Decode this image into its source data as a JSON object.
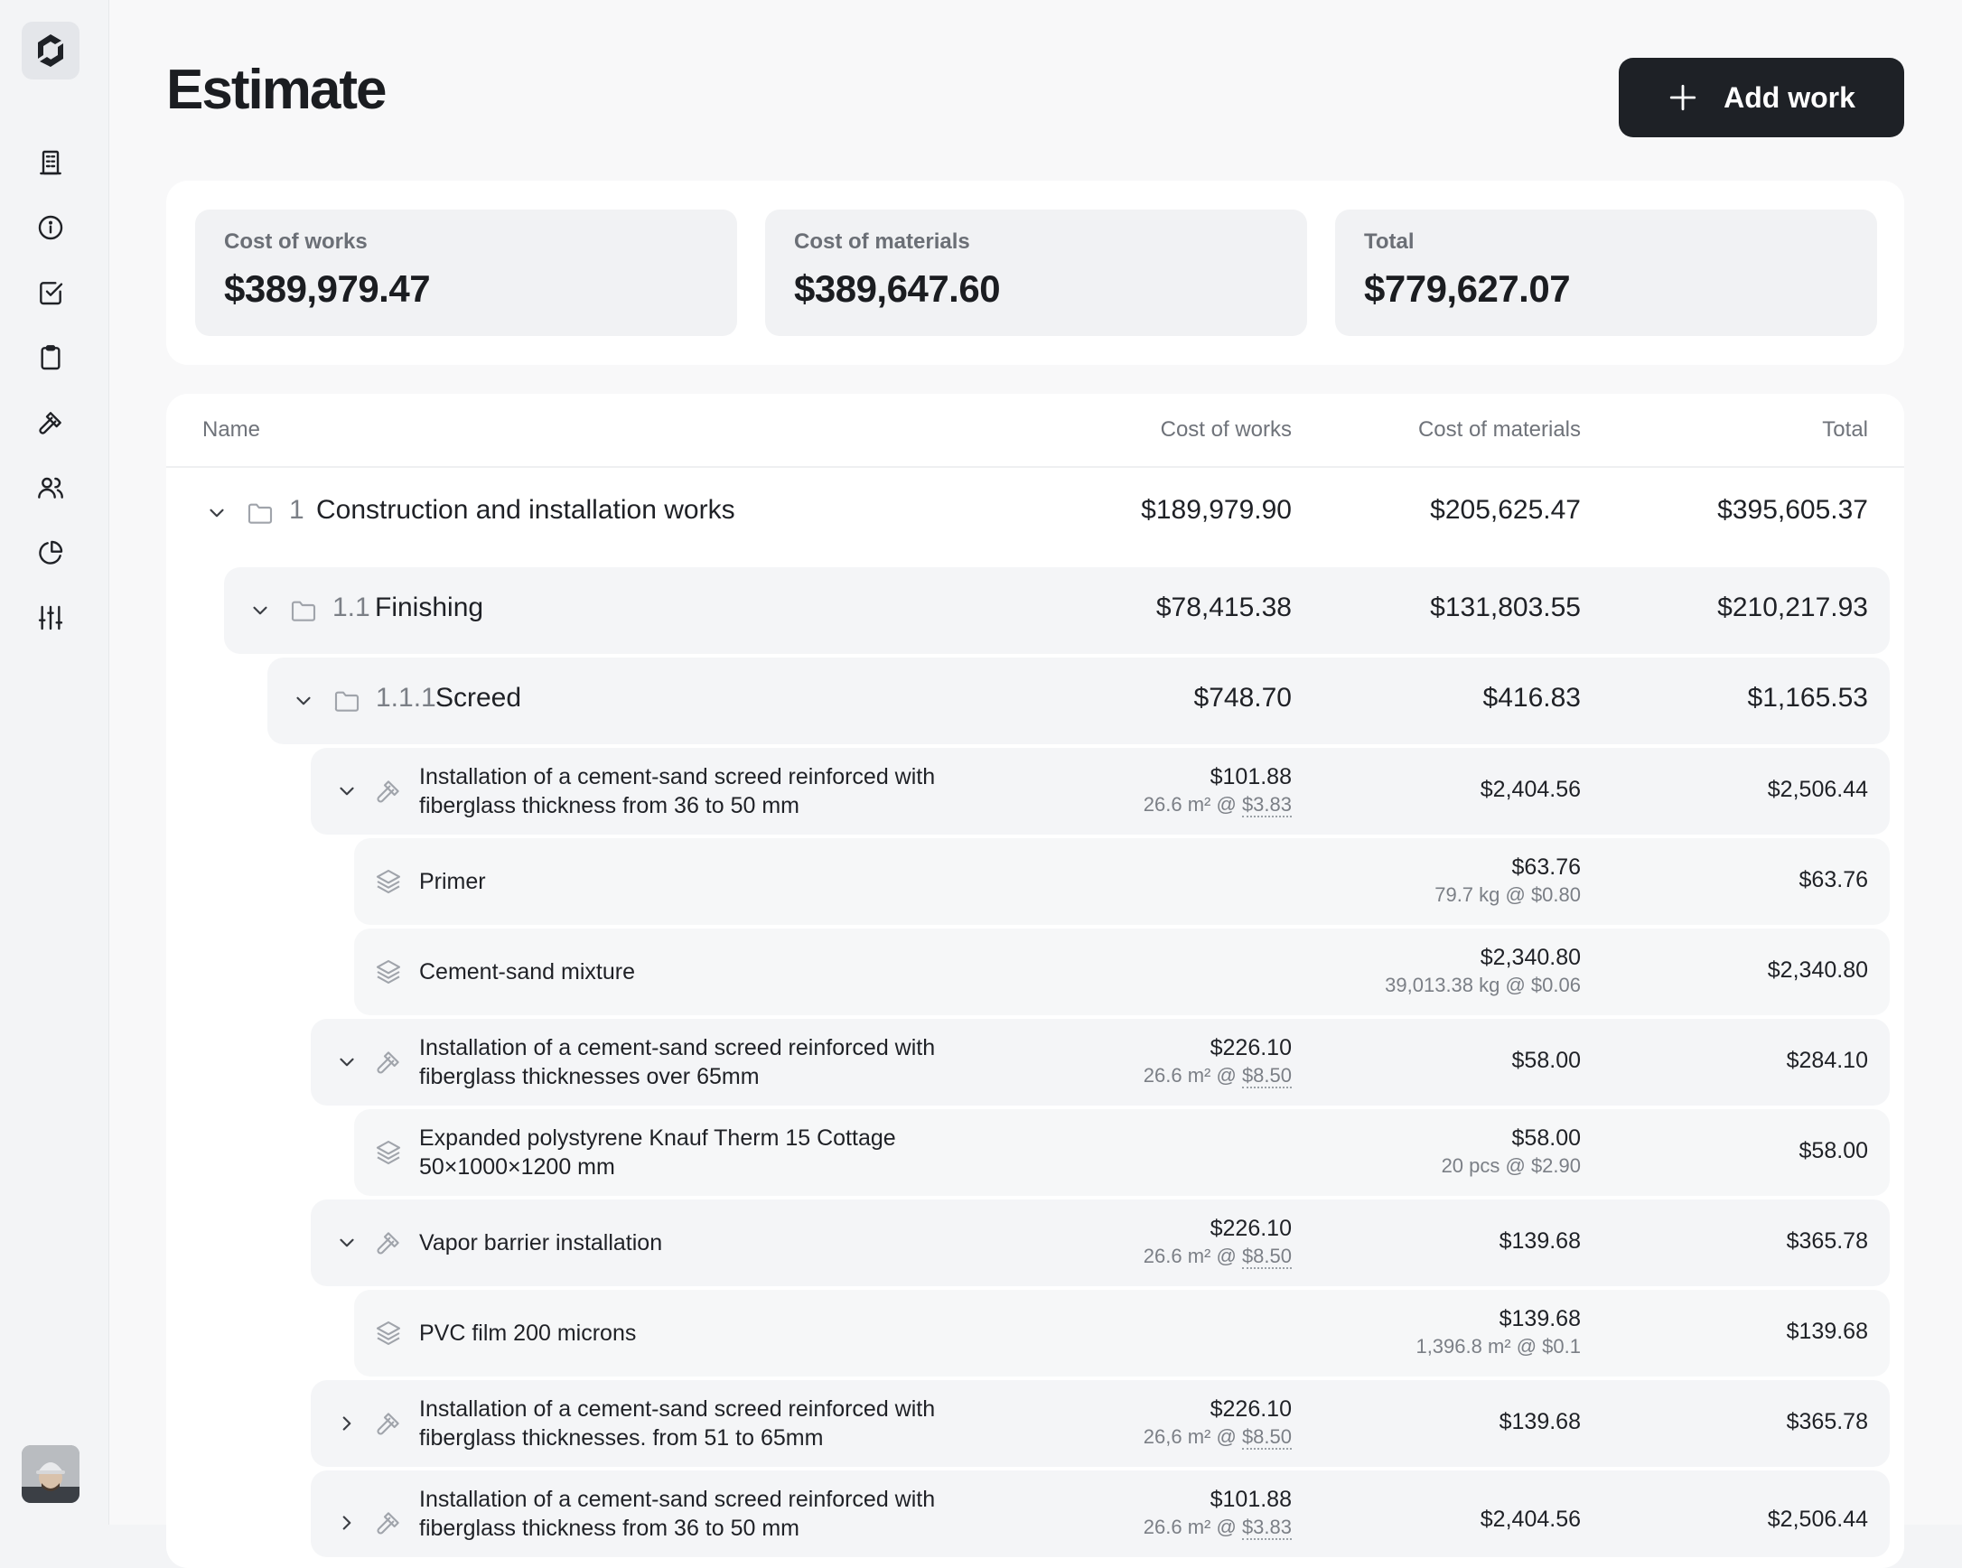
{
  "page": {
    "title": "Estimate",
    "add_button": "Add work"
  },
  "sidebar": {
    "items": [
      {
        "icon": "building-icon"
      },
      {
        "icon": "info-icon"
      },
      {
        "icon": "checkbox-icon"
      },
      {
        "icon": "clipboard-icon"
      },
      {
        "icon": "hammer-icon"
      },
      {
        "icon": "users-icon"
      },
      {
        "icon": "pie-chart-icon"
      },
      {
        "icon": "sliders-icon"
      }
    ]
  },
  "summary": {
    "works": {
      "label": "Cost of works",
      "value": "$389,979.47"
    },
    "materials": {
      "label": "Cost of materials",
      "value": "$389,647.60"
    },
    "total": {
      "label": "Total",
      "value": "$779,627.07"
    }
  },
  "table": {
    "columns": {
      "name": "Name",
      "works": "Cost of works",
      "materials": "Cost of materials",
      "total": "Total"
    },
    "rows": [
      {
        "level": 0,
        "type": "section",
        "num": "1",
        "name": "Construction and installation works",
        "works": "$189,979.90",
        "materials": "$205,625.47",
        "total": "$395,605.37"
      },
      {
        "level": 1,
        "type": "section",
        "num": "1.1",
        "name": "Finishing",
        "works": "$78,415.38",
        "materials": "$131,803.55",
        "total": "$210,217.93"
      },
      {
        "level": 2,
        "type": "section",
        "num": "1.1.1",
        "name": "Screed",
        "works": "$748.70",
        "materials": "$416.83",
        "total": "$1,165.53"
      },
      {
        "level": 3,
        "type": "work",
        "expanded": true,
        "name": "Installation of a cement-sand screed reinforced with fiberglass thickness from 36 to 50 mm",
        "works": "$101.88",
        "works_qty": "26.6 m² @ ",
        "works_rate": "$3.83",
        "materials": "$2,404.56",
        "total": "$2,506.44"
      },
      {
        "level": 4,
        "type": "material",
        "name": "Primer",
        "materials": "$63.76",
        "materials_qty": "79.7 kg @ $0.80",
        "total": "$63.76"
      },
      {
        "level": 4,
        "type": "material",
        "name": "Cement-sand mixture",
        "materials": "$2,340.80",
        "materials_qty": "39,013.38 kg @ $0.06",
        "total": "$2,340.80"
      },
      {
        "level": 3,
        "type": "work",
        "expanded": true,
        "name": "Installation of a cement-sand screed reinforced with fiberglass thicknesses over 65mm",
        "works": "$226.10",
        "works_qty": "26.6 m² @ ",
        "works_rate": "$8.50",
        "materials": "$58.00",
        "total": "$284.10"
      },
      {
        "level": 4,
        "type": "material",
        "name": "Expanded polystyrene Knauf Therm 15 Cottage 50×1000×1200 mm",
        "materials": "$58.00",
        "materials_qty": "20 pcs @ $2.90",
        "total": "$58.00"
      },
      {
        "level": 3,
        "type": "work",
        "expanded": true,
        "name": "Vapor barrier installation",
        "works": "$226.10",
        "works_qty": "26.6 m² @ ",
        "works_rate": "$8.50",
        "materials": "$139.68",
        "total": "$365.78"
      },
      {
        "level": 4,
        "type": "material",
        "name": "PVC film 200 microns",
        "materials": "$139.68",
        "materials_qty": "1,396.8 m² @ $0.1",
        "total": "$139.68"
      },
      {
        "level": 3,
        "type": "work",
        "expanded": false,
        "name": "Installation of a cement-sand screed reinforced with fiberglass thicknesses. from 51 to 65mm",
        "works": "$226.10",
        "works_qty": "26,6 m² @ ",
        "works_rate": "$8.50",
        "materials": "$139.68",
        "total": "$365.78"
      },
      {
        "level": 3,
        "type": "work",
        "expanded": false,
        "name": "Installation of a cement-sand screed reinforced with fiberglass thickness from 36 to 50 mm",
        "works": "$101.88",
        "works_qty": "26.6 m² @ ",
        "works_rate": "$3.83",
        "materials": "$2,404.56",
        "total": "$2,506.44"
      }
    ]
  }
}
